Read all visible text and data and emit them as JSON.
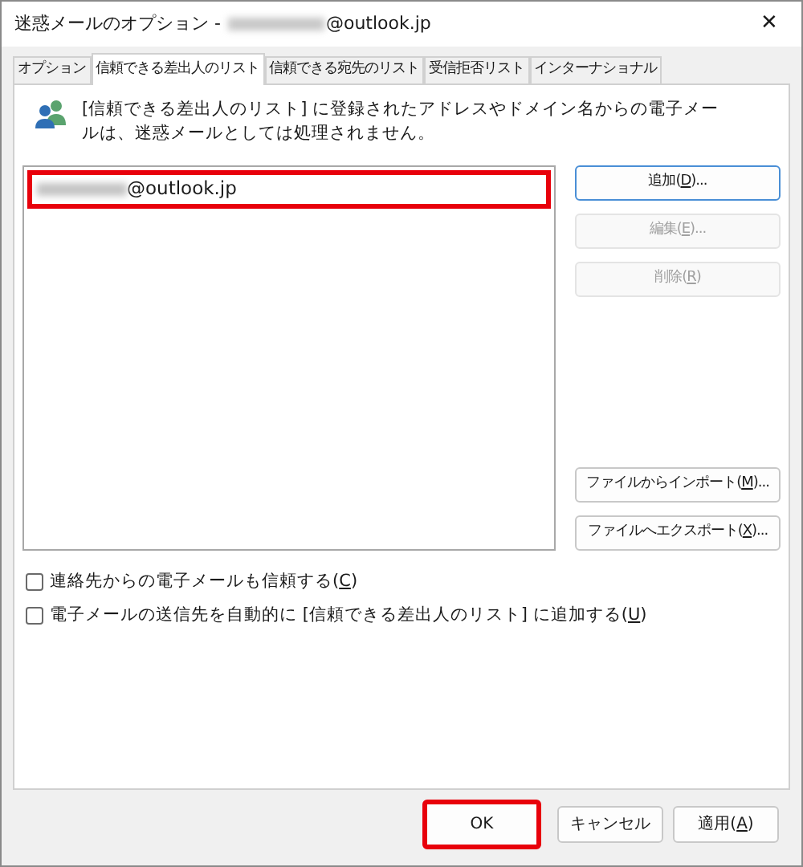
{
  "window": {
    "title_prefix": "迷惑メールのオプション - ",
    "title_suffix": "@outlook.jp",
    "close": "✕"
  },
  "tabs": [
    {
      "label": "オプション",
      "selected": false
    },
    {
      "label": "信頼できる差出人のリスト",
      "selected": true
    },
    {
      "label": "信頼できる宛先のリスト",
      "selected": false
    },
    {
      "label": "受信拒否リスト",
      "selected": false
    },
    {
      "label": "インターナショナル",
      "selected": false
    }
  ],
  "description": "[信頼できる差出人のリスト] に登録されたアドレスやドメイン名からの電子メールは、迷惑メールとしては処理されません。",
  "list": {
    "items": [
      {
        "text": "@outlook.jp",
        "highlighted": true
      }
    ]
  },
  "side_buttons": [
    {
      "pre": "追加(",
      "key": "D",
      "post": ")...",
      "disabled": false
    },
    {
      "pre": "編集(",
      "key": "E",
      "post": ")...",
      "disabled": true
    },
    {
      "pre": "削除(",
      "key": "R",
      "post": ")",
      "disabled": true
    },
    {
      "pre": "ファイルからインポート(",
      "key": "M",
      "post": ")...",
      "disabled": false
    },
    {
      "pre": "ファイルへエクスポート(",
      "key": "X",
      "post": ")...",
      "disabled": false
    }
  ],
  "checkboxes": [
    {
      "pre": "連絡先からの電子メールも信頼する(",
      "key": "C",
      "post": ")",
      "checked": false
    },
    {
      "pre": "電子メールの送信先を自動的に [信頼できる差出人のリスト] に追加する(",
      "key": "U",
      "post": ")",
      "checked": false
    }
  ],
  "footer_buttons": [
    {
      "pre": "OK",
      "highlighted": true
    },
    {
      "pre": "キャンセル",
      "highlighted": false
    },
    {
      "pre": "適用(",
      "key": "A",
      "post": ")",
      "highlighted": false
    }
  ]
}
